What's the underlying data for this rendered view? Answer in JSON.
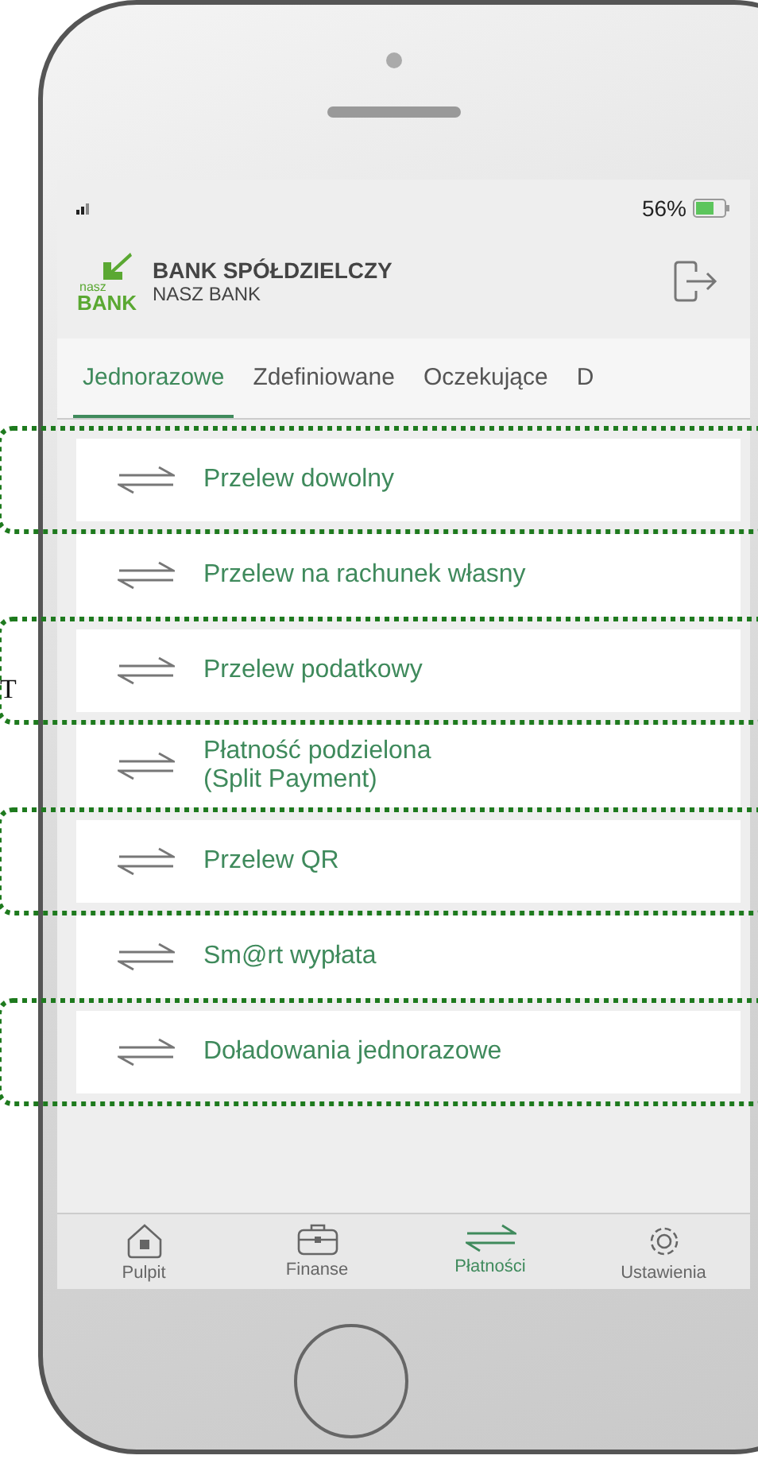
{
  "status_bar": {
    "battery": "56%"
  },
  "header": {
    "logo_small": "nasz",
    "logo_big": "BANK",
    "title": "BANK SPÓŁDZIELCZY",
    "subtitle": "NASZ BANK"
  },
  "tabs": [
    {
      "label": "Jednorazowe",
      "selected": true
    },
    {
      "label": "Zdefiniowane",
      "selected": false
    },
    {
      "label": "Oczekujące",
      "selected": false
    },
    {
      "label": "D",
      "selected": false
    }
  ],
  "transfers": [
    {
      "lines": [
        "Przelew dowolny"
      ],
      "highlighted": true
    },
    {
      "lines": [
        "Przelew na rachunek własny"
      ],
      "highlighted": false
    },
    {
      "lines": [
        "Przelew podatkowy"
      ],
      "highlighted": true
    },
    {
      "lines": [
        "Płatność podzielona",
        "(Split Payment)"
      ],
      "highlighted": false
    },
    {
      "lines": [
        "Przelew QR"
      ],
      "highlighted": true
    },
    {
      "lines": [
        "Sm@rt wypłata"
      ],
      "highlighted": false
    },
    {
      "lines": [
        "Doładowania jednorazowe"
      ],
      "highlighted": true
    }
  ],
  "bottom_nav": [
    {
      "kind": "home",
      "label": "Pulpit",
      "selected": false
    },
    {
      "kind": "wallet",
      "label": "Finanse",
      "selected": false
    },
    {
      "kind": "transfer",
      "label": "Płatności",
      "selected": true
    },
    {
      "kind": "settings",
      "label": "Ustawienia",
      "selected": false
    }
  ],
  "side_text": "T"
}
